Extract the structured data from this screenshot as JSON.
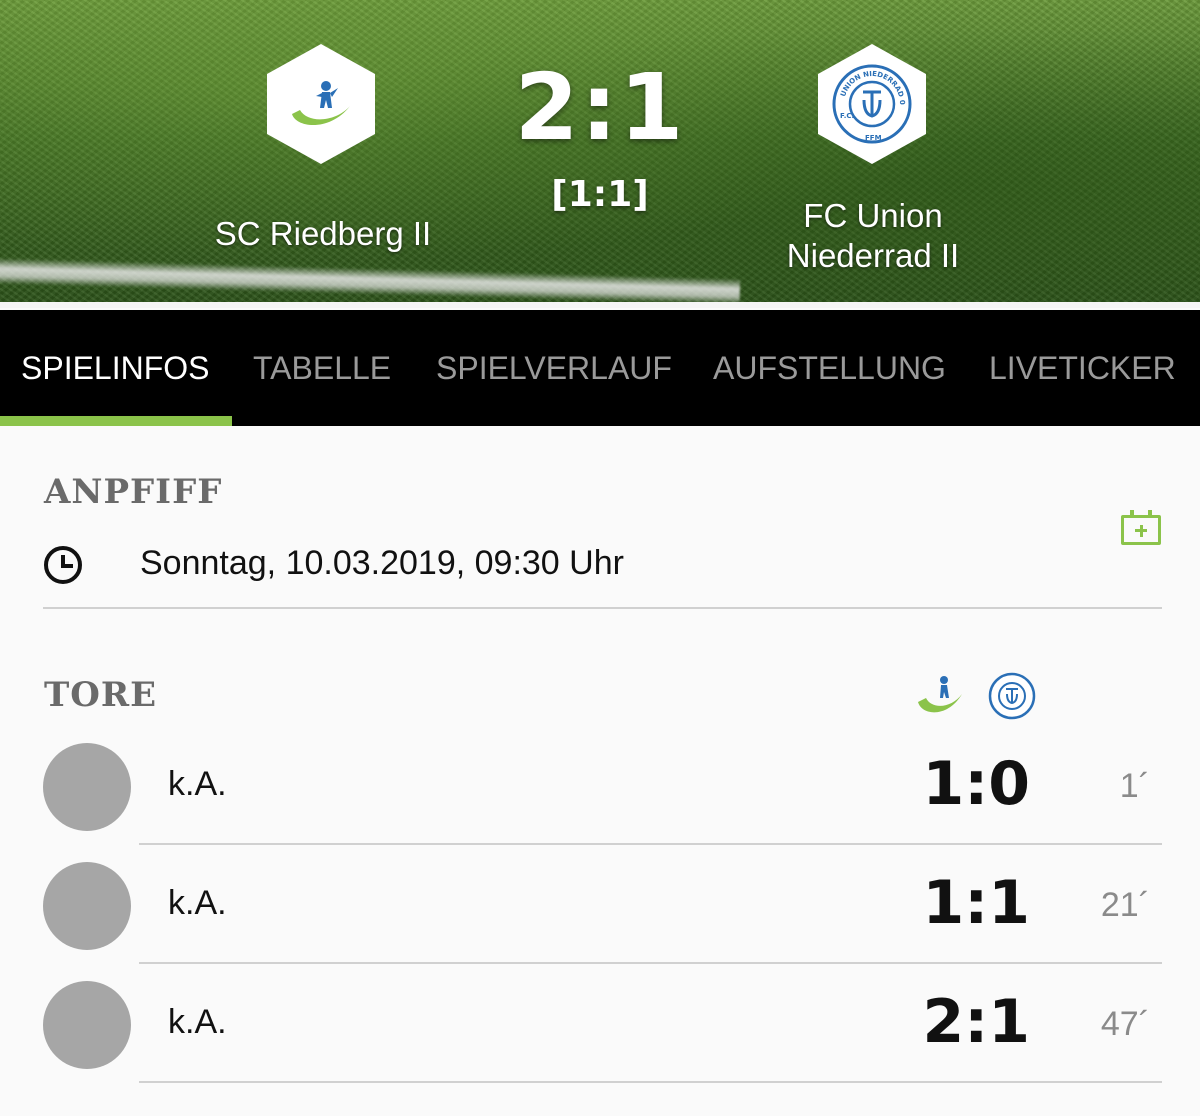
{
  "match": {
    "home_team": "SC Riedberg II",
    "away_team_line1": "FC Union",
    "away_team_line2": "Niederrad II",
    "score": "2:1",
    "halftime": "[1:1]",
    "home_logo_icon": "sc-riedberg-logo-icon",
    "away_logo_icon": "fc-union-niederrad-logo-icon",
    "away_logo_text_top": "UNION NIEDERRAD 07",
    "away_logo_text_left": "F.C.",
    "away_logo_text_bottom": "FFM"
  },
  "tabs": [
    {
      "label": "SPIELINFOS",
      "active": true
    },
    {
      "label": "TABELLE",
      "active": false
    },
    {
      "label": "SPIELVERLAUF",
      "active": false
    },
    {
      "label": "AUFSTELLUNG",
      "active": false
    },
    {
      "label": "LIVETICKER",
      "active": false
    }
  ],
  "kickoff": {
    "title": "ANPFIFF",
    "datetime": "Sonntag, 10.03.2019, 09:30 Uhr",
    "clock_icon": "clock-icon",
    "calendar_icon": "calendar-add-icon"
  },
  "goals": {
    "title": "TORE",
    "items": [
      {
        "scorer": "k.A.",
        "score": "1:0",
        "minute": "1´"
      },
      {
        "scorer": "k.A.",
        "score": "1:1",
        "minute": "21´"
      },
      {
        "scorer": "k.A.",
        "score": "2:1",
        "minute": "47´"
      }
    ]
  },
  "colors": {
    "accent": "#8bc34a",
    "tab_bar": "#000000",
    "away_blue": "#2a6fb6",
    "avatar_gray": "#a6a6a6"
  }
}
